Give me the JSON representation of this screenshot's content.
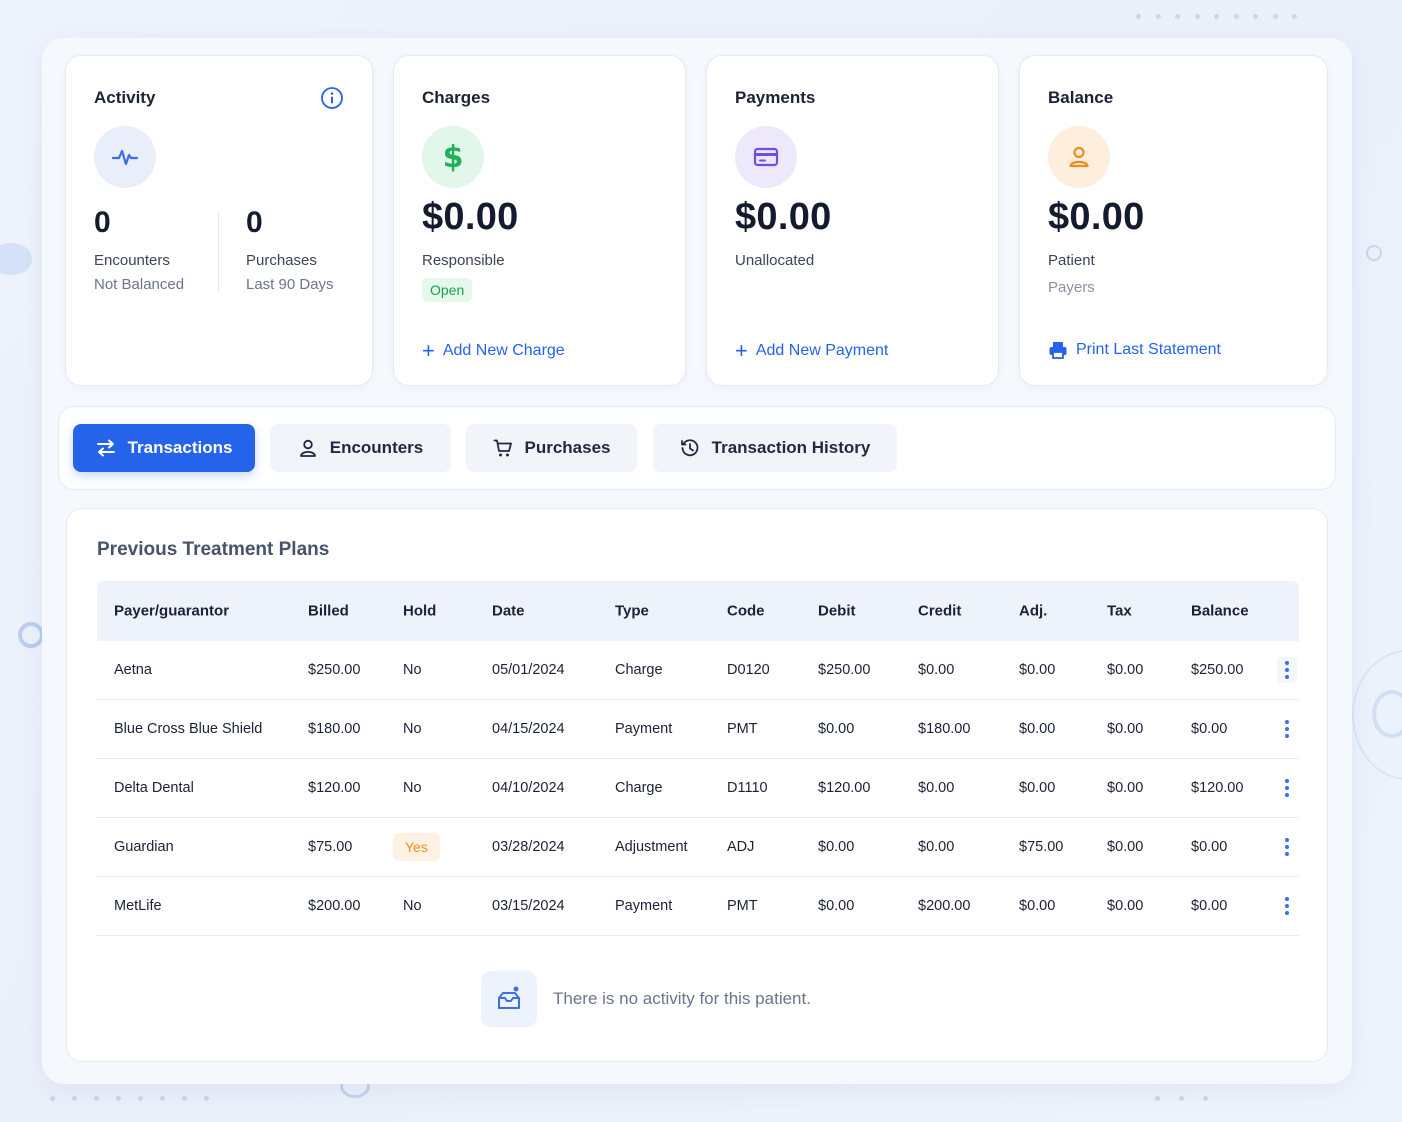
{
  "activity": {
    "title": "Activity",
    "encounters_count": "0",
    "encounters_label": "Encounters",
    "encounters_sub": "Not Balanced",
    "purchases_count": "0",
    "purchases_label": "Purchases",
    "purchases_sub": "Last 90 Days"
  },
  "charges": {
    "title": "Charges",
    "amount": "$0.00",
    "label": "Responsible",
    "badge": "Open",
    "link": "Add New Charge"
  },
  "payments": {
    "title": "Payments",
    "amount": "$0.00",
    "label": "Unallocated",
    "link": "Add New Payment"
  },
  "balance": {
    "title": "Balance",
    "amount": "$0.00",
    "label": "Patient",
    "sub": "Payers",
    "link": "Print Last Statement"
  },
  "tabs": [
    {
      "label": "Transactions",
      "icon": "swap-arrows-icon",
      "active": true
    },
    {
      "label": "Encounters",
      "icon": "user-icon",
      "active": false
    },
    {
      "label": "Purchases",
      "icon": "cart-icon",
      "active": false
    },
    {
      "label": "Transaction History",
      "icon": "history-icon",
      "active": false
    }
  ],
  "table": {
    "title": "Previous Treatment Plans",
    "columns": [
      "Payer/guarantor",
      "Billed",
      "Hold",
      "Date",
      "Type",
      "Code",
      "Debit",
      "Credit",
      "Adj.",
      "Tax",
      "Balance"
    ],
    "rows": [
      [
        "Aetna",
        "$250.00",
        "No",
        "05/01/2024",
        "Charge",
        "D0120",
        "$250.00",
        "$0.00",
        "$0.00",
        "$0.00",
        "$250.00"
      ],
      [
        "Blue Cross Blue Shield",
        "$180.00",
        "No",
        "04/15/2024",
        "Payment",
        "PMT",
        "$0.00",
        "$180.00",
        "$0.00",
        "$0.00",
        "$0.00"
      ],
      [
        "Delta Dental",
        "$120.00",
        "No",
        "04/10/2024",
        "Charge",
        "D1110",
        "$120.00",
        "$0.00",
        "$0.00",
        "$0.00",
        "$120.00"
      ],
      [
        "Guardian",
        "$75.00",
        "Yes",
        "03/28/2024",
        "Adjustment",
        "ADJ",
        "$0.00",
        "$0.00",
        "$75.00",
        "$0.00",
        "$0.00"
      ],
      [
        "MetLife",
        "$200.00",
        "No",
        "03/15/2024",
        "Payment",
        "PMT",
        "$0.00",
        "$200.00",
        "$0.00",
        "$0.00",
        "$0.00"
      ]
    ],
    "empty_message": "There is no activity for this patient."
  },
  "colors": {
    "primary": "#2563eb",
    "success": "#17a34a",
    "warning": "#f08c1a",
    "purple": "#6d4ee6"
  }
}
